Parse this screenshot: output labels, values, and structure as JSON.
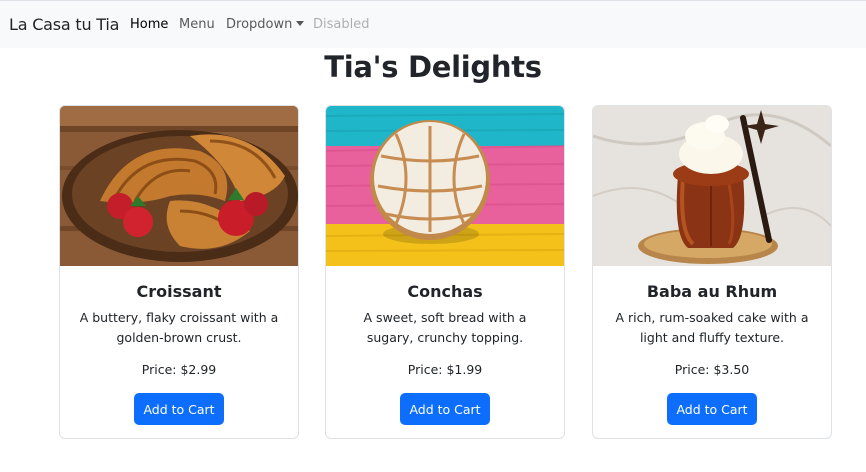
{
  "navbar": {
    "brand": "La Casa tu Tia",
    "links": [
      {
        "label": "Home",
        "state": "active"
      },
      {
        "label": "Menu",
        "state": "normal"
      },
      {
        "label": "Dropdown",
        "state": "dropdown"
      },
      {
        "label": "Disabled",
        "state": "disabled"
      }
    ]
  },
  "page": {
    "title": "Tia's Delights"
  },
  "colors": {
    "primary_button": "#0d6efd",
    "navbar_bg": "#f8f9fa"
  },
  "products": [
    {
      "title": "Croissant",
      "description": "A buttery, flaky croissant with a golden-brown crust.",
      "price": "Price: $2.99",
      "button": "Add to Cart",
      "image": "croissants-with-strawberries-photo"
    },
    {
      "title": "Conchas",
      "description": "A sweet, soft bread with a sugary, crunchy topping.",
      "price": "Price: $1.99",
      "button": "Add to Cart",
      "image": "concha-on-striped-background-photo"
    },
    {
      "title": "Baba au Rhum",
      "description": "A rich, rum-soaked cake with a light and fluffy texture.",
      "price": "Price: $3.50",
      "button": "Add to Cart",
      "image": "baba-au-rhum-with-cream-photo"
    }
  ]
}
